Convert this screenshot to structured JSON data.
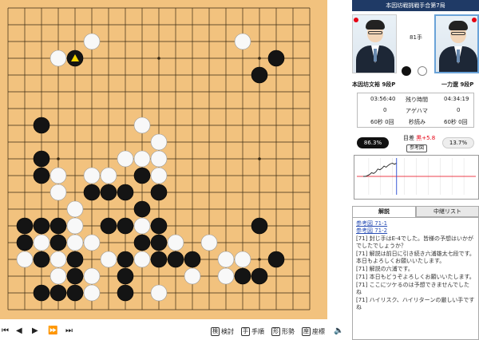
{
  "header": {
    "title": "本因坊戦挑戦手合第7局"
  },
  "move": {
    "label": "81手"
  },
  "players": {
    "black": {
      "name": "本因坊文裕",
      "rank": "9段P"
    },
    "white": {
      "name": "一力遼",
      "rank": "9段P"
    }
  },
  "stats": {
    "rows": [
      {
        "left": "03:56:40",
        "label": "残り時間",
        "right": "04:34:19"
      },
      {
        "left": "0",
        "label": "アゲハマ",
        "right": "0"
      },
      {
        "left": "60秒 0回",
        "label": "秒読み",
        "right": "60秒 0回"
      }
    ]
  },
  "eval": {
    "black_pct": "86.3%",
    "white_pct": "13.7%",
    "margin_label": "目差",
    "margin_value": "黒+5.8",
    "ref_button": "参考図"
  },
  "graph": {
    "winrate_black": [
      50,
      50,
      52,
      55,
      60,
      58,
      62,
      70,
      68,
      72,
      78,
      75,
      80,
      84,
      86,
      83,
      86
    ]
  },
  "tabs": {
    "commentary": "解説",
    "relay": "中継リスト"
  },
  "commentary": {
    "links": [
      "参考図 71-1",
      "参考図 71-2"
    ],
    "lines": [
      "[71] 封じ手はE-4でした。皆様の予想はいかがでしたでしょうか？",
      "[71] 解説は前日に引き続き六浦雄太七段です。本日もよろしくお願いいたします。",
      "[71] 解説の六浦です。",
      "[71] 本日もどうぞよろしくお願いいたします。",
      "[71] ここにツケるのは予想できませんでしたね",
      "[71] ハイリスク、ハイリターンの厳しい手ですね"
    ]
  },
  "controls": {
    "nav": [
      "⏮",
      "◀",
      "▶",
      "⏩",
      "⏭"
    ],
    "tools": [
      {
        "label": "検討",
        "icon": "検"
      },
      {
        "label": "手順",
        "icon": "手"
      },
      {
        "label": "形勢",
        "icon": "形"
      },
      {
        "label": "座標",
        "icon": "座"
      }
    ],
    "sound_icon": "🔈"
  },
  "board": {
    "size": 19,
    "last_move": [
      4,
      3
    ],
    "black": [
      [
        4,
        3
      ],
      [
        16,
        3
      ],
      [
        15,
        4
      ],
      [
        2,
        7
      ],
      [
        2,
        9
      ],
      [
        2,
        10
      ],
      [
        8,
        10
      ],
      [
        5,
        11
      ],
      [
        6,
        11
      ],
      [
        7,
        11
      ],
      [
        9,
        11
      ],
      [
        8,
        12
      ],
      [
        1,
        13
      ],
      [
        2,
        13
      ],
      [
        3,
        13
      ],
      [
        6,
        13
      ],
      [
        7,
        13
      ],
      [
        9,
        13
      ],
      [
        15,
        13
      ],
      [
        1,
        14
      ],
      [
        3,
        14
      ],
      [
        8,
        14
      ],
      [
        9,
        14
      ],
      [
        2,
        15
      ],
      [
        4,
        15
      ],
      [
        7,
        15
      ],
      [
        9,
        15
      ],
      [
        10,
        15
      ],
      [
        11,
        15
      ],
      [
        16,
        15
      ],
      [
        4,
        16
      ],
      [
        7,
        16
      ],
      [
        14,
        16
      ],
      [
        15,
        16
      ],
      [
        2,
        17
      ],
      [
        3,
        17
      ],
      [
        4,
        17
      ],
      [
        7,
        17
      ]
    ],
    "white": [
      [
        5,
        2
      ],
      [
        14,
        2
      ],
      [
        3,
        3
      ],
      [
        8,
        7
      ],
      [
        9,
        8
      ],
      [
        7,
        9
      ],
      [
        8,
        9
      ],
      [
        9,
        9
      ],
      [
        3,
        10
      ],
      [
        5,
        10
      ],
      [
        6,
        10
      ],
      [
        9,
        10
      ],
      [
        3,
        11
      ],
      [
        4,
        12
      ],
      [
        4,
        13
      ],
      [
        4,
        14
      ],
      [
        2,
        14
      ],
      [
        5,
        14
      ],
      [
        8,
        13
      ],
      [
        10,
        14
      ],
      [
        12,
        14
      ],
      [
        1,
        15
      ],
      [
        3,
        15
      ],
      [
        6,
        15
      ],
      [
        8,
        15
      ],
      [
        13,
        15
      ],
      [
        14,
        15
      ],
      [
        3,
        16
      ],
      [
        5,
        16
      ],
      [
        11,
        16
      ],
      [
        13,
        16
      ],
      [
        5,
        17
      ],
      [
        9,
        17
      ]
    ]
  }
}
